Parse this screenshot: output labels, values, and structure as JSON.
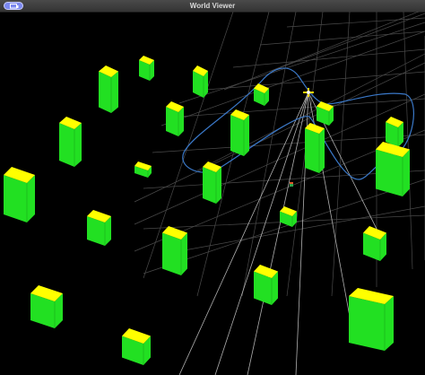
{
  "window": {
    "title": "World Viewer"
  },
  "toolbar": {
    "menu_icon": "display-icon"
  },
  "scene": {
    "background": "#000000",
    "grid_color": "#4a4a4a",
    "path_color": "#3a78c8",
    "box_top_color": "#ffff00",
    "box_side_color": "#22e022",
    "drone_color": "#ffd400"
  }
}
